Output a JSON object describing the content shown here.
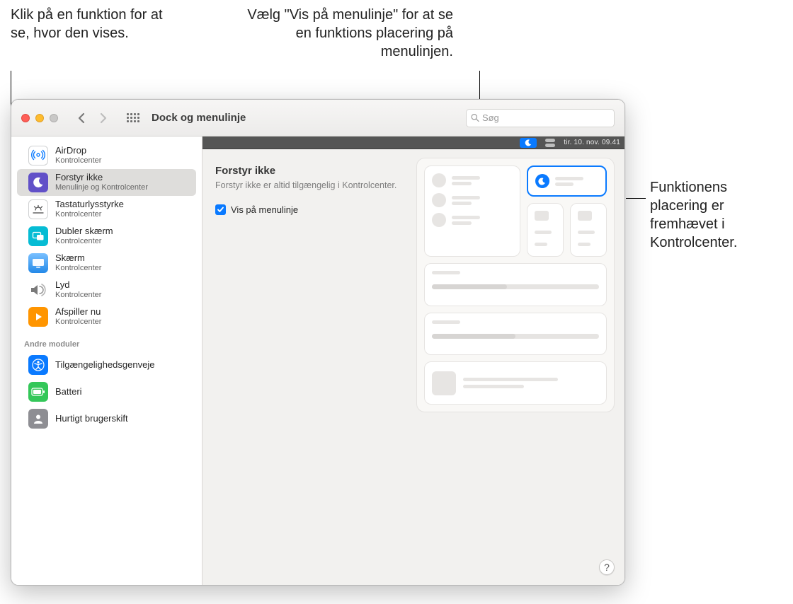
{
  "callouts": {
    "top_left": "Klik på en funktion for at se, hvor den vises.",
    "top_right": "Vælg \"Vis på menulinje\" for at se en funktions placering på menulinjen.",
    "right": "Funktionens placering er fremhævet i Kontrolcenter."
  },
  "window": {
    "title": "Dock og menulinje",
    "search_placeholder": "Søg"
  },
  "sidebar": {
    "items": [
      {
        "title": "AirDrop",
        "subtitle": "Kontrolcenter",
        "icon": "airdrop"
      },
      {
        "title": "Forstyr ikke",
        "subtitle": "Menulinje og Kontrolcenter",
        "icon": "dnd",
        "selected": true
      },
      {
        "title": "Tastaturlysstyrke",
        "subtitle": "Kontrolcenter",
        "icon": "keyboard"
      },
      {
        "title": "Dubler skærm",
        "subtitle": "Kontrolcenter",
        "icon": "mirror"
      },
      {
        "title": "Skærm",
        "subtitle": "Kontrolcenter",
        "icon": "display"
      },
      {
        "title": "Lyd",
        "subtitle": "Kontrolcenter",
        "icon": "sound"
      },
      {
        "title": "Afspiller nu",
        "subtitle": "Kontrolcenter",
        "icon": "play"
      }
    ],
    "section_other": "Andre moduler",
    "other_items": [
      {
        "title": "Tilgængelighedsgenveje",
        "icon": "accessibility"
      },
      {
        "title": "Batteri",
        "icon": "battery"
      },
      {
        "title": "Hurtigt brugerskift",
        "icon": "user"
      }
    ]
  },
  "main": {
    "heading": "Forstyr ikke",
    "description": "Forstyr ikke er altid tilgængelig i Kontrolcenter.",
    "checkbox_label": "Vis på menulinje",
    "checked": true,
    "menubar_datetime": "tir. 10. nov.  09.41",
    "help": "?"
  }
}
